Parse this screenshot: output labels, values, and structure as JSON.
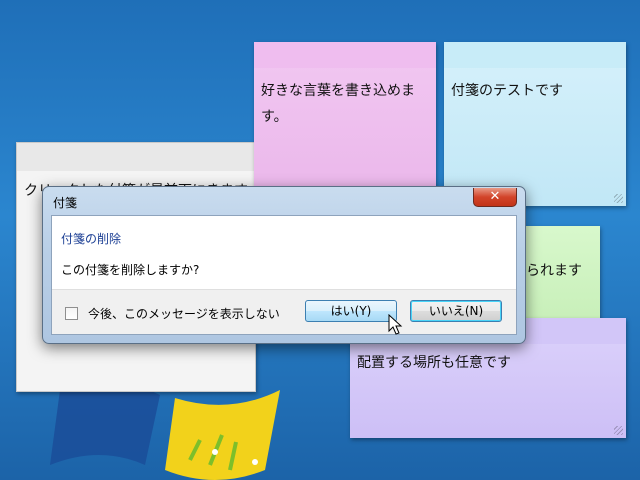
{
  "notes": {
    "white": "クリックした付箋が最前面にきます",
    "pink": "好きな言葉を書き込めます。",
    "blue": "付箋のテストです",
    "green": "えられます",
    "purple": "配置する場所も任意です"
  },
  "dialog": {
    "title": "付箋",
    "close_label": "✕",
    "heading": "付箋の削除",
    "message": "この付箋を削除しますか?",
    "checkbox_label": "今後、このメッセージを表示しない",
    "checkbox_checked": false,
    "yes_label": "はい(Y)",
    "no_label": "いいえ(N)"
  },
  "colors": {
    "desktop": "#2b86cf",
    "note_pink": "#eab6ea",
    "note_blue": "#c1e7f6",
    "note_green": "#c7efb8",
    "note_purple": "#cdbff6",
    "close_button": "#d2442a"
  }
}
